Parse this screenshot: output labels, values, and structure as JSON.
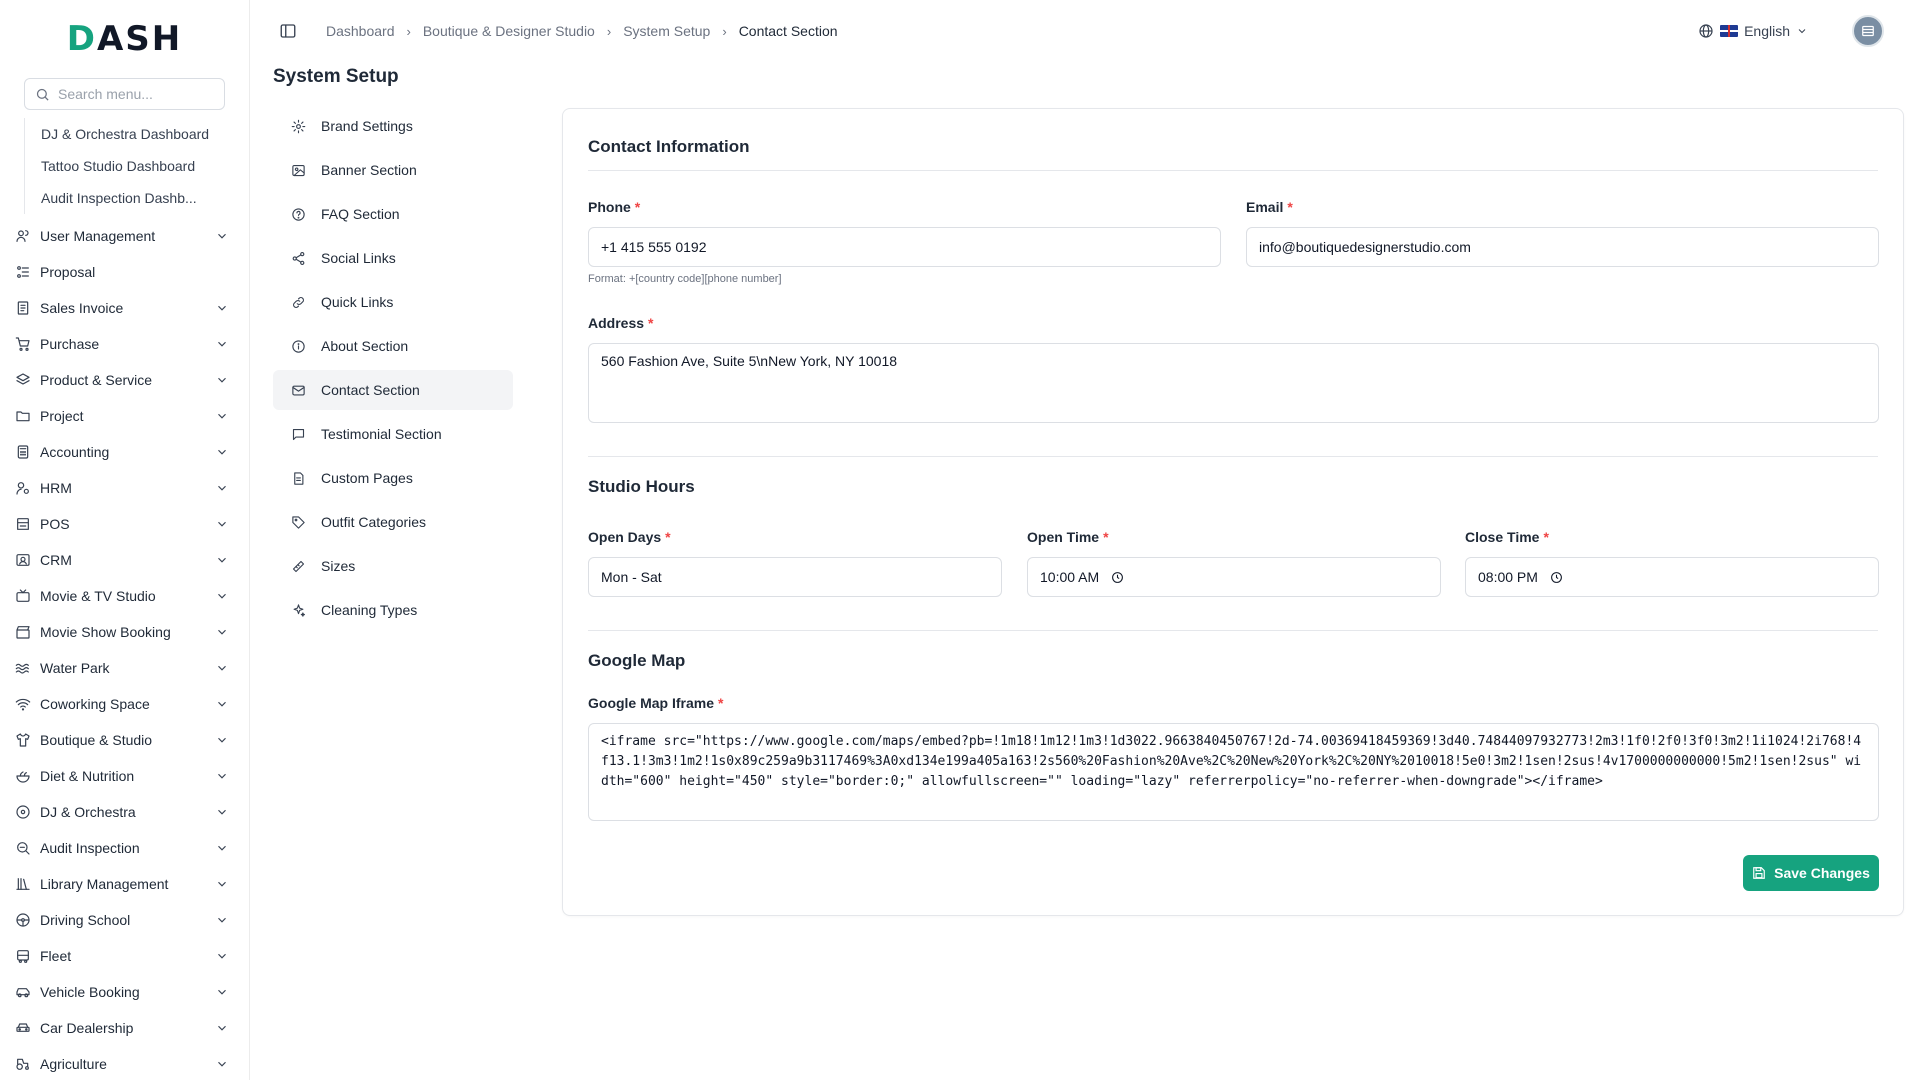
{
  "logo": {
    "text_a": "D",
    "text_b": "ASH"
  },
  "sidebar": {
    "search_placeholder": "Search menu...",
    "sub_items": [
      "DJ & Orchestra Dashboard",
      "Tattoo Studio Dashboard",
      "Audit Inspection Dashb..."
    ],
    "items": [
      {
        "label": "User Management",
        "icon": "users-icon",
        "has_children": true
      },
      {
        "label": "Proposal",
        "icon": "proposal-icon",
        "has_children": false
      },
      {
        "label": "Sales Invoice",
        "icon": "invoice-icon",
        "has_children": true
      },
      {
        "label": "Purchase",
        "icon": "cart-icon",
        "has_children": true
      },
      {
        "label": "Product & Service",
        "icon": "layers-icon",
        "has_children": true
      },
      {
        "label": "Project",
        "icon": "folder-icon",
        "has_children": true
      },
      {
        "label": "Accounting",
        "icon": "calculator-icon",
        "has_children": true
      },
      {
        "label": "HRM",
        "icon": "hrm-icon",
        "has_children": true
      },
      {
        "label": "POS",
        "icon": "pos-icon",
        "has_children": true
      },
      {
        "label": "CRM",
        "icon": "crm-icon",
        "has_children": true
      },
      {
        "label": "Movie & TV Studio",
        "icon": "tv-icon",
        "has_children": true
      },
      {
        "label": "Movie Show Booking",
        "icon": "clapperboard-icon",
        "has_children": true
      },
      {
        "label": "Water Park",
        "icon": "waves-icon",
        "has_children": true
      },
      {
        "label": "Coworking Space",
        "icon": "wifi-icon",
        "has_children": true
      },
      {
        "label": "Boutique & Studio",
        "icon": "shirt-icon",
        "has_children": true
      },
      {
        "label": "Diet & Nutrition",
        "icon": "salad-icon",
        "has_children": true
      },
      {
        "label": "DJ & Orchestra",
        "icon": "disc-icon",
        "has_children": true
      },
      {
        "label": "Audit Inspection",
        "icon": "search-zoom-icon",
        "has_children": true
      },
      {
        "label": "Library Management",
        "icon": "library-icon",
        "has_children": true
      },
      {
        "label": "Driving School",
        "icon": "steering-wheel-icon",
        "has_children": true
      },
      {
        "label": "Fleet",
        "icon": "bus-icon",
        "has_children": true
      },
      {
        "label": "Vehicle Booking",
        "icon": "car-icon",
        "has_children": true
      },
      {
        "label": "Car Dealership",
        "icon": "car-front-icon",
        "has_children": true
      },
      {
        "label": "Agriculture",
        "icon": "tractor-icon",
        "has_children": true
      }
    ]
  },
  "header": {
    "breadcrumbs": [
      "Dashboard",
      "Boutique & Designer Studio",
      "System Setup",
      "Contact Section"
    ],
    "language": "English"
  },
  "page": {
    "title": "System Setup"
  },
  "settings_nav": [
    {
      "label": "Brand Settings",
      "icon": "gear-icon",
      "active": false
    },
    {
      "label": "Banner Section",
      "icon": "image-icon",
      "active": false
    },
    {
      "label": "FAQ Section",
      "icon": "help-circle-icon",
      "active": false
    },
    {
      "label": "Social Links",
      "icon": "share-icon",
      "active": false
    },
    {
      "label": "Quick Links",
      "icon": "link-icon",
      "active": false
    },
    {
      "label": "About Section",
      "icon": "info-icon",
      "active": false
    },
    {
      "label": "Contact Section",
      "icon": "mail-icon",
      "active": true
    },
    {
      "label": "Testimonial Section",
      "icon": "message-square-icon",
      "active": false
    },
    {
      "label": "Custom Pages",
      "icon": "file-text-icon",
      "active": false
    },
    {
      "label": "Outfit Categories",
      "icon": "tag-icon",
      "active": false
    },
    {
      "label": "Sizes",
      "icon": "ruler-icon",
      "active": false
    },
    {
      "label": "Cleaning Types",
      "icon": "sparkles-icon",
      "active": false
    }
  ],
  "form": {
    "contact": {
      "title": "Contact Information",
      "phone_label": "Phone",
      "phone_value": "+1 415 555 0192",
      "phone_hint": "Format: +[country code][phone number]",
      "email_label": "Email",
      "email_value": "info@boutiquedesignerstudio.com",
      "address_label": "Address",
      "address_value": "560 Fashion Ave, Suite 5\\nNew York, NY 10018"
    },
    "hours": {
      "title": "Studio Hours",
      "open_days_label": "Open Days",
      "open_days_value": "Mon - Sat",
      "open_time_label": "Open Time",
      "open_time_value": "10:00 AM",
      "close_time_label": "Close Time",
      "close_time_value": "08:00 PM"
    },
    "map": {
      "title": "Google Map",
      "iframe_label": "Google Map Iframe",
      "iframe_value": "<iframe src=\"https://www.google.com/maps/embed?pb=!1m18!1m12!1m3!1d3022.9663840450767!2d-74.00369418459369!3d40.74844097932773!2m3!1f0!2f0!3f0!3m2!1i1024!2i768!4f13.1!3m3!1m2!1s0x89c259a9b3117469%3A0xd134e199a405a163!2s560%20Fashion%20Ave%2C%20New%20York%2C%20NY%2010018!5e0!3m2!1sen!2sus!4v1700000000000!5m2!1sen!2sus\" width=\"600\" height=\"450\" style=\"border:0;\" allowfullscreen=\"\" loading=\"lazy\" referrerpolicy=\"no-referrer-when-downgrade\"></iframe>"
    },
    "required_mark": "*",
    "save_label": "Save Changes"
  },
  "colors": {
    "accent": "#16a37f",
    "required": "#ef4444"
  }
}
